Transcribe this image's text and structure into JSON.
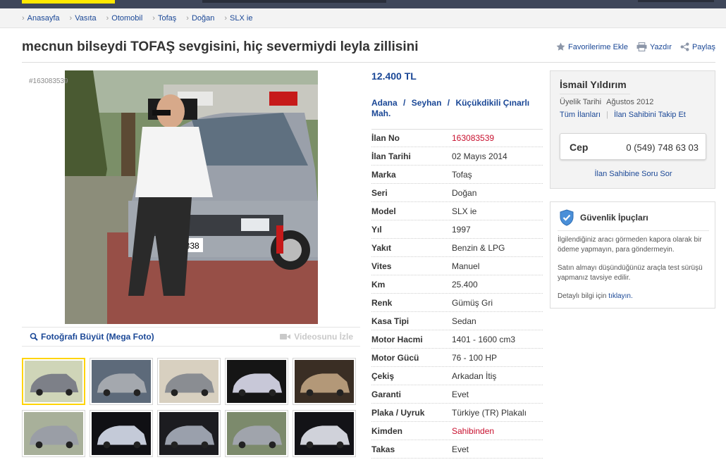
{
  "breadcrumb": [
    "Anasayfa",
    "Vasıta",
    "Otomobil",
    "Tofaş",
    "Doğan",
    "SLX ie"
  ],
  "listing": {
    "title": "mecnun bilseydi TOFAŞ sevgisini, hiç severmiydi leyla zillisini",
    "photo_id": "#163083539",
    "price": "12.400 TL",
    "location": {
      "city": "Adana",
      "district": "Seyhan",
      "neighborhood": "Küçükdikili Çınarlı Mah.",
      "separator": "/"
    }
  },
  "actions": {
    "favorite": "Favorilerime Ekle",
    "print": "Yazdır",
    "share": "Paylaş"
  },
  "gallery": {
    "mega_label": "Fotoğrafı Büyüt (Mega Foto)",
    "video_label": "Videosunu İzle",
    "thumbnail_count": 10
  },
  "details": [
    {
      "k": "İlan No",
      "v": "163083539",
      "red": true
    },
    {
      "k": "İlan Tarihi",
      "v": "02 Mayıs 2014"
    },
    {
      "k": "Marka",
      "v": "Tofaş"
    },
    {
      "k": "Seri",
      "v": "Doğan"
    },
    {
      "k": "Model",
      "v": "SLX ie"
    },
    {
      "k": "Yıl",
      "v": "1997"
    },
    {
      "k": "Yakıt",
      "v": "Benzin & LPG"
    },
    {
      "k": "Vites",
      "v": "Manuel"
    },
    {
      "k": "Km",
      "v": "25.400"
    },
    {
      "k": "Renk",
      "v": "Gümüş Gri"
    },
    {
      "k": "Kasa Tipi",
      "v": "Sedan"
    },
    {
      "k": "Motor Hacmi",
      "v": "1401 - 1600 cm3"
    },
    {
      "k": "Motor Gücü",
      "v": "76 - 100 HP"
    },
    {
      "k": "Çekiş",
      "v": "Arkadan İtiş"
    },
    {
      "k": "Garanti",
      "v": "Evet"
    },
    {
      "k": "Plaka / Uyruk",
      "v": "Türkiye (TR) Plakalı"
    },
    {
      "k": "Kimden",
      "v": "Sahibinden",
      "red": true
    },
    {
      "k": "Takas",
      "v": "Evet"
    }
  ],
  "seller": {
    "name": "İsmail Yıldırım",
    "member_label": "Üyelik Tarihi",
    "member_since": "Ağustos 2012",
    "all_listings": "Tüm İlanları",
    "follow": "İlan Sahibini Takip Et",
    "phone_label": "Cep",
    "phone": "0 (549) 748 63 03",
    "ask": "İlan Sahibine Soru Sor"
  },
  "safety": {
    "title": "Güvenlik İpuçları",
    "tip1": "İlgilendiğiniz aracı görmeden kapora olarak bir ödeme yapmayın, para göndermeyin.",
    "tip2": "Satın almayı düşündüğünüz araçla test sürüşü yapmanız tavsiye edilir.",
    "more_prefix": "Detaylı bilgi için ",
    "more_link": "tıklayın."
  },
  "colors": {
    "link": "#1a4796",
    "red": "#c8102e",
    "brand_yellow": "#ffe800",
    "topbar": "#3f475a"
  }
}
